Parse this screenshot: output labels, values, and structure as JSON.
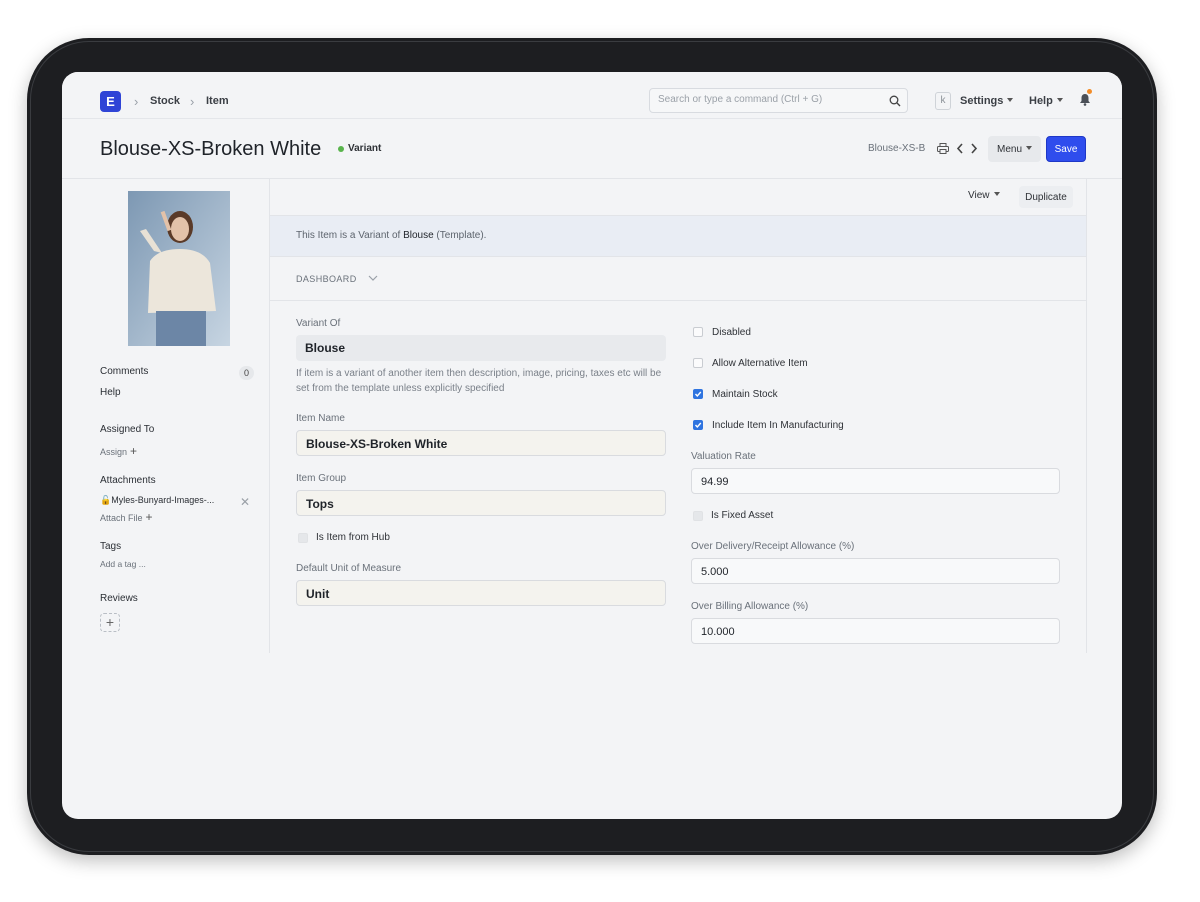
{
  "navbar": {
    "logo": "E",
    "breadcrumbs": [
      "Stock",
      "Item"
    ],
    "search_placeholder": "Search or type a command (Ctrl + G)",
    "shortcut_key": "k",
    "settings": "Settings",
    "help": "Help"
  },
  "header": {
    "title": "Blouse-XS-Broken White",
    "status": "Variant",
    "doc_short": "Blouse-XS-B",
    "menu_label": "Menu",
    "save_label": "Save"
  },
  "sidebar": {
    "comments_label": "Comments",
    "comments_count": "0",
    "help_label": "Help",
    "assigned_to": "Assigned To",
    "assign": "Assign",
    "attachments": "Attachments",
    "attachment_file": "Myles-Bunyard-Images-...",
    "attach_file": "Attach File",
    "tags": "Tags",
    "add_tag": "Add a tag ...",
    "reviews": "Reviews"
  },
  "toolbar": {
    "view": "View",
    "duplicate": "Duplicate"
  },
  "banner": {
    "prefix": "This Item is a Variant of ",
    "template_name": "Blouse",
    "suffix": " (Template)."
  },
  "dashboard_label": "DASHBOARD",
  "form": {
    "variant_of_label": "Variant Of",
    "variant_of_value": "Blouse",
    "variant_desc": "If item is a variant of another item then description, image, pricing, taxes etc will be set from the template unless explicitly specified",
    "item_name_label": "Item Name",
    "item_name_value": "Blouse-XS-Broken White",
    "item_group_label": "Item Group",
    "item_group_value": "Tops",
    "is_item_from_hub": "Is Item from Hub",
    "uom_label": "Default Unit of Measure",
    "uom_value": "Unit",
    "disabled": "Disabled",
    "allow_alt": "Allow Alternative Item",
    "maintain_stock": "Maintain Stock",
    "include_mfg": "Include Item In Manufacturing",
    "valuation_label": "Valuation Rate",
    "valuation_value": "94.99",
    "fixed_asset": "Is Fixed Asset",
    "over_delivery_label": "Over Delivery/Receipt Allowance (%)",
    "over_delivery_value": "5.000",
    "over_billing_label": "Over Billing Allowance (%)",
    "over_billing_value": "10.000"
  },
  "checks": {
    "disabled": false,
    "allow_alt": false,
    "maintain_stock": true,
    "include_mfg": true,
    "fixed_asset": false,
    "is_item_from_hub": false
  }
}
